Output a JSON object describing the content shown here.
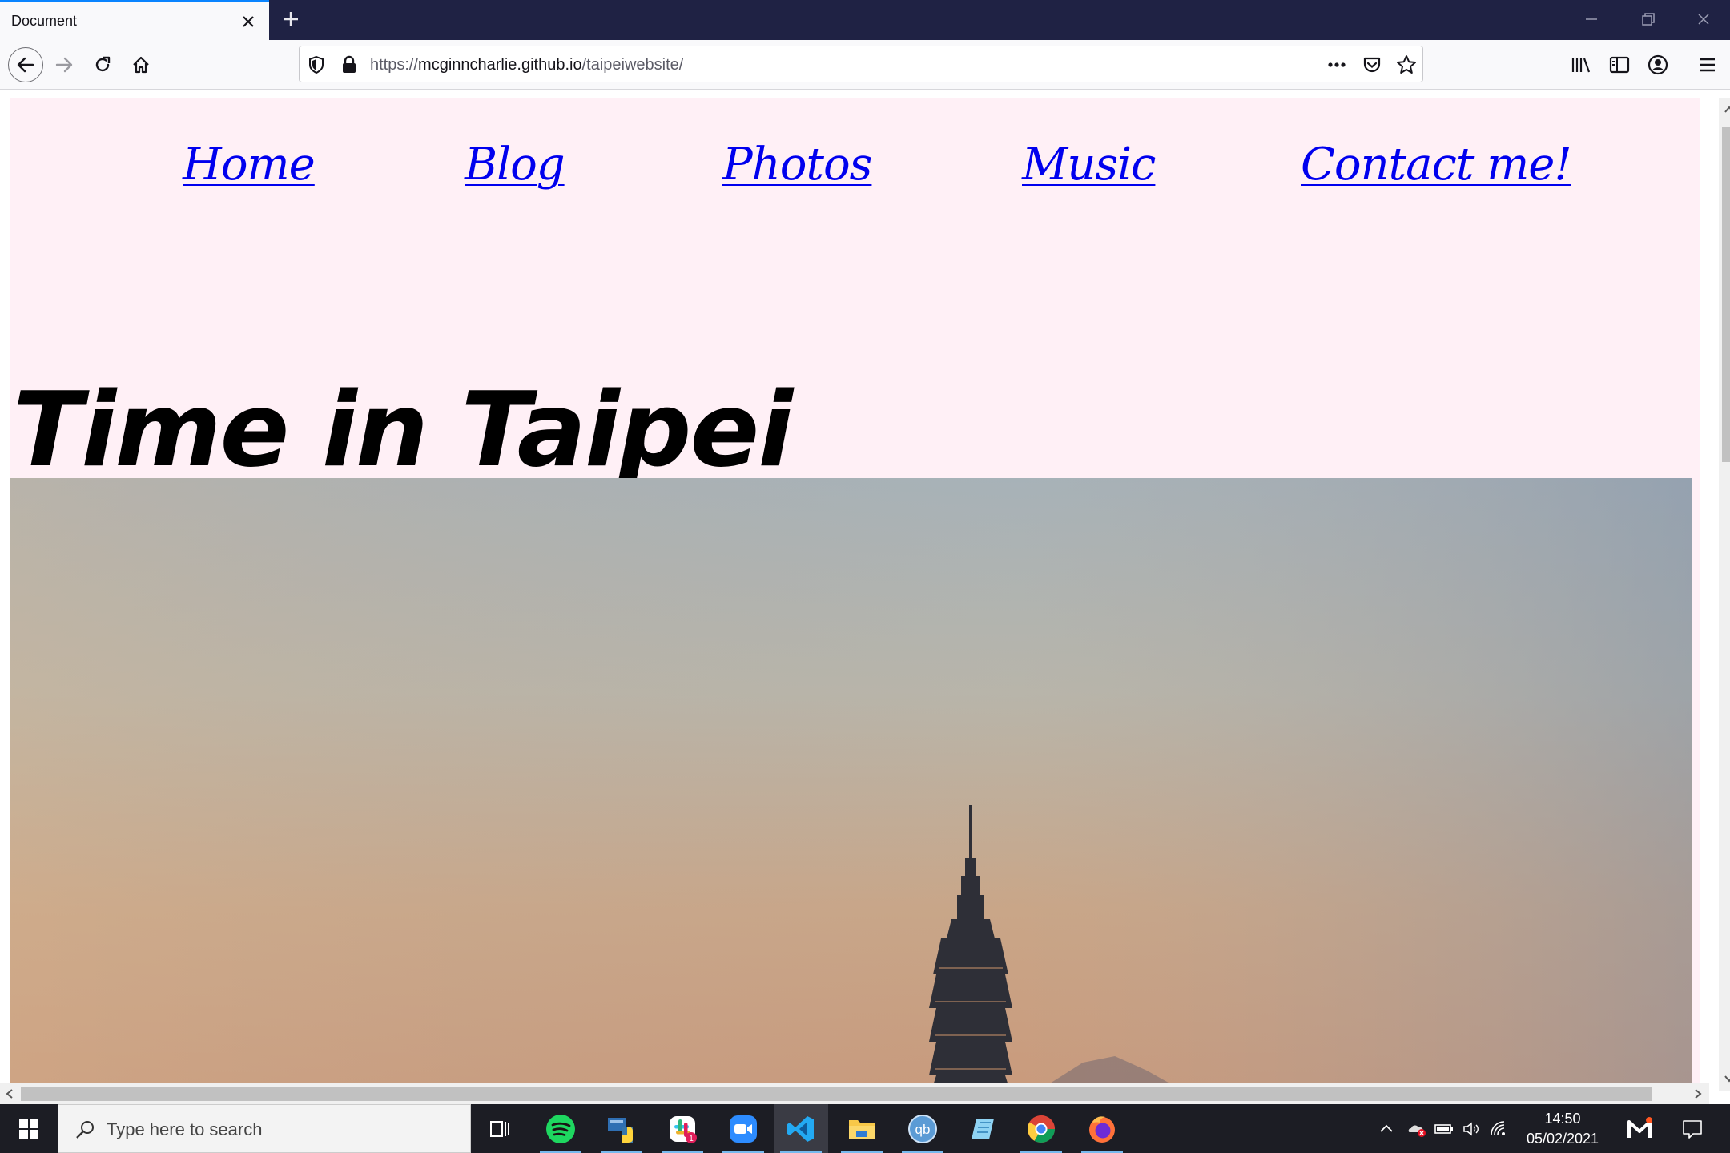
{
  "browser": {
    "tab_title": "Document",
    "url_prefix": "https://",
    "url_domain": "mcginncharlie.github.io",
    "url_path": "/taipeiwebsite/"
  },
  "page": {
    "nav": [
      "Home",
      "Blog",
      "Photos",
      "Music",
      "Contact me!"
    ],
    "title": "Time in Taipei",
    "link_color": "#0000ee",
    "background_color": "#fff0f6"
  },
  "taskbar": {
    "search_placeholder": "Type here to search",
    "time": "14:50",
    "date": "05/02/2021",
    "slack_badge": "1",
    "qb_label": "qb"
  },
  "icons": {
    "apps": [
      "task-view-icon",
      "spotify-icon",
      "python-icon",
      "slack-icon",
      "zoom-icon",
      "vscode-icon",
      "file-explorer-icon",
      "qbittorrent-icon",
      "notepad-icon",
      "chrome-icon",
      "firefox-icon"
    ]
  }
}
